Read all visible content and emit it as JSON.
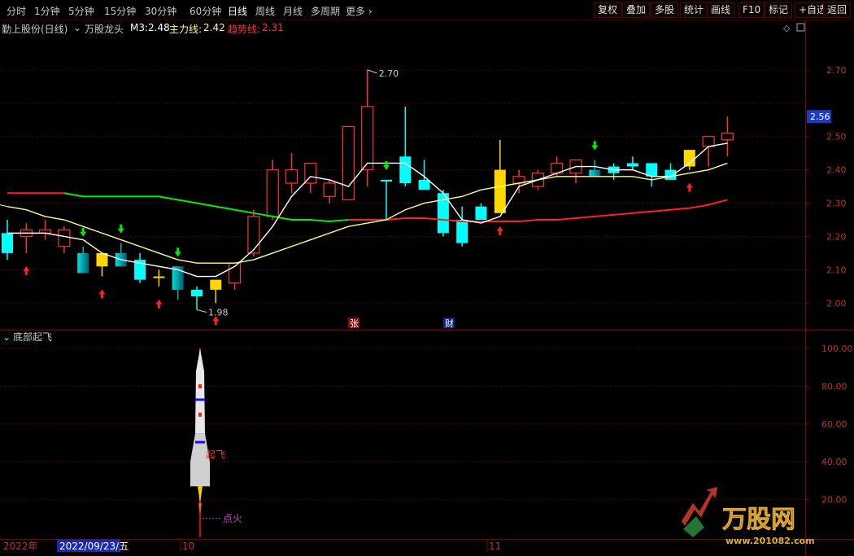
{
  "toolbar": {
    "periods": [
      "分时",
      "1分钟",
      "5分钟",
      "15分钟",
      "30分钟",
      "60分钟",
      "日线",
      "周线",
      "月线",
      "多周期",
      "更多"
    ],
    "active_period": "日线",
    "buttons": [
      "复权",
      "叠加",
      "多股",
      "统计",
      "画线",
      "F10",
      "标记",
      "+自选",
      "返回"
    ]
  },
  "info": {
    "stock": "勤上股份(日线)",
    "indicator": "万股龙头",
    "m3_label": "M3:",
    "m3_value": "2.48",
    "main_label": "主力线:",
    "main_value": "2.42",
    "trend_label": "趋势线:",
    "trend_value": "2.31"
  },
  "sub_panel": {
    "title": "底部起飞",
    "rocket_label": "起飞",
    "ignite_label": "点火"
  },
  "dates": {
    "year": "2022年",
    "selected": "2022/09/23/五",
    "m1": "10",
    "m2": "11"
  },
  "markers": {
    "zhang": "张",
    "cai": "财"
  },
  "watermark": {
    "brand": "万股网",
    "url": "www.201082.com"
  },
  "colors": {
    "up": "#ff3232",
    "down_cyan": "#00ffff",
    "down_teal": "#00b4b4",
    "gold": "#ffd700",
    "m3": "#ffffff",
    "main": "#ffff80",
    "trend_up": "#ff2020",
    "trend_down": "#00ff00"
  },
  "chart_data": [
    {
      "type": "candlestick",
      "title": "勤上股份(日线)",
      "y_ticks": [
        2.0,
        2.1,
        2.2,
        2.3,
        2.4,
        2.5,
        2.7
      ],
      "current_price": 2.56,
      "candles": [
        {
          "o": 2.15,
          "h": 2.25,
          "l": 2.13,
          "c": 2.21,
          "col": "cyan"
        },
        {
          "o": 2.2,
          "h": 2.24,
          "l": 2.15,
          "c": 2.22,
          "col": "red"
        },
        {
          "o": 2.21,
          "h": 2.25,
          "l": 2.19,
          "c": 2.22,
          "col": "red"
        },
        {
          "o": 2.17,
          "h": 2.23,
          "l": 2.15,
          "c": 2.22,
          "col": "red"
        },
        {
          "o": 2.15,
          "h": 2.17,
          "l": 2.09,
          "c": 2.09,
          "col": "teal"
        },
        {
          "o": 2.15,
          "h": 2.15,
          "l": 2.08,
          "c": 2.11,
          "col": "gold"
        },
        {
          "o": 2.15,
          "h": 2.18,
          "l": 2.11,
          "c": 2.11,
          "col": "teal"
        },
        {
          "o": 2.13,
          "h": 2.15,
          "l": 2.06,
          "c": 2.07,
          "col": "cyan"
        },
        {
          "o": 2.08,
          "h": 2.1,
          "l": 2.05,
          "c": 2.08,
          "col": "gold"
        },
        {
          "o": 2.11,
          "h": 2.11,
          "l": 2.01,
          "c": 2.04,
          "col": "teal"
        },
        {
          "o": 2.04,
          "h": 2.05,
          "l": 1.98,
          "c": 2.02,
          "col": "cyan"
        },
        {
          "o": 2.04,
          "h": 2.07,
          "l": 2.0,
          "c": 2.07,
          "col": "gold"
        },
        {
          "o": 2.06,
          "h": 2.12,
          "l": 2.04,
          "c": 2.12,
          "col": "red"
        },
        {
          "o": 2.15,
          "h": 2.28,
          "l": 2.14,
          "c": 2.26,
          "col": "red"
        },
        {
          "o": 2.26,
          "h": 2.43,
          "l": 2.25,
          "c": 2.4,
          "col": "red"
        },
        {
          "o": 2.36,
          "h": 2.45,
          "l": 2.33,
          "c": 2.4,
          "col": "red"
        },
        {
          "o": 2.36,
          "h": 2.42,
          "l": 2.33,
          "c": 2.42,
          "col": "red"
        },
        {
          "o": 2.32,
          "h": 2.37,
          "l": 2.3,
          "c": 2.36,
          "col": "red"
        },
        {
          "o": 2.31,
          "h": 2.53,
          "l": 2.31,
          "c": 2.53,
          "col": "red"
        },
        {
          "o": 2.4,
          "h": 2.7,
          "l": 2.35,
          "c": 2.59,
          "col": "red"
        },
        {
          "o": 2.37,
          "h": 2.37,
          "l": 2.25,
          "c": 2.37,
          "col": "cyan"
        },
        {
          "o": 2.44,
          "h": 2.59,
          "l": 2.35,
          "c": 2.36,
          "col": "cyan"
        },
        {
          "o": 2.37,
          "h": 2.43,
          "l": 2.34,
          "c": 2.34,
          "col": "cyan"
        },
        {
          "o": 2.33,
          "h": 2.34,
          "l": 2.2,
          "c": 2.21,
          "col": "cyan"
        },
        {
          "o": 2.25,
          "h": 2.29,
          "l": 2.17,
          "c": 2.18,
          "col": "cyan"
        },
        {
          "o": 2.29,
          "h": 2.3,
          "l": 2.25,
          "c": 2.25,
          "col": "cyan"
        },
        {
          "o": 2.4,
          "h": 2.49,
          "l": 2.27,
          "c": 2.27,
          "col": "gold"
        },
        {
          "o": 2.36,
          "h": 2.4,
          "l": 2.33,
          "c": 2.38,
          "col": "red"
        },
        {
          "o": 2.35,
          "h": 2.4,
          "l": 2.34,
          "c": 2.39,
          "col": "red"
        },
        {
          "o": 2.39,
          "h": 2.44,
          "l": 2.38,
          "c": 2.42,
          "col": "red"
        },
        {
          "o": 2.39,
          "h": 2.43,
          "l": 2.36,
          "c": 2.43,
          "col": "red"
        },
        {
          "o": 2.4,
          "h": 2.43,
          "l": 2.38,
          "c": 2.38,
          "col": "teal"
        },
        {
          "o": 2.41,
          "h": 2.42,
          "l": 2.37,
          "c": 2.39,
          "col": "cyan"
        },
        {
          "o": 2.42,
          "h": 2.44,
          "l": 2.4,
          "c": 2.41,
          "col": "cyan"
        },
        {
          "o": 2.42,
          "h": 2.42,
          "l": 2.35,
          "c": 2.38,
          "col": "cyan"
        },
        {
          "o": 2.4,
          "h": 2.42,
          "l": 2.37,
          "c": 2.37,
          "col": "cyan"
        },
        {
          "o": 2.41,
          "h": 2.46,
          "l": 2.4,
          "c": 2.46,
          "col": "gold"
        },
        {
          "o": 2.47,
          "h": 2.5,
          "l": 2.41,
          "c": 2.5,
          "col": "red"
        },
        {
          "o": 2.49,
          "h": 2.56,
          "l": 2.44,
          "c": 2.51,
          "col": "red"
        }
      ],
      "m3_line": [
        2.21,
        2.21,
        2.21,
        2.2,
        2.19,
        2.15,
        2.13,
        2.12,
        2.11,
        2.1,
        2.08,
        2.08,
        2.11,
        2.16,
        2.23,
        2.32,
        2.38,
        2.37,
        2.35,
        2.42,
        2.42,
        2.42,
        2.38,
        2.33,
        2.25,
        2.24,
        2.26,
        2.35,
        2.37,
        2.39,
        2.41,
        2.41,
        2.4,
        2.4,
        2.38,
        2.38,
        2.42,
        2.47,
        2.48
      ],
      "main_line": [
        2.29,
        2.28,
        2.26,
        2.25,
        2.23,
        2.21,
        2.19,
        2.17,
        2.15,
        2.13,
        2.12,
        2.12,
        2.12,
        2.13,
        2.15,
        2.17,
        2.19,
        2.21,
        2.23,
        2.24,
        2.25,
        2.28,
        2.3,
        2.31,
        2.32,
        2.34,
        2.35,
        2.36,
        2.37,
        2.38,
        2.38,
        2.38,
        2.38,
        2.38,
        2.37,
        2.38,
        2.39,
        2.4,
        2.42
      ],
      "trend_line": [
        2.33,
        2.33,
        2.33,
        2.33,
        2.32,
        2.32,
        2.32,
        2.32,
        2.32,
        2.31,
        2.3,
        2.29,
        2.28,
        2.27,
        2.26,
        2.25,
        2.25,
        2.245,
        2.25,
        2.25,
        2.25,
        2.255,
        2.255,
        2.25,
        2.245,
        2.245,
        2.245,
        2.245,
        2.25,
        2.25,
        2.255,
        2.26,
        2.265,
        2.27,
        2.275,
        2.28,
        2.285,
        2.295,
        2.31
      ],
      "trend_green_until": 18,
      "labels": {
        "high": "2.70",
        "low": "1.98"
      },
      "up_arrows": [
        1,
        5,
        8,
        11,
        26,
        36
      ],
      "down_arrows": [
        4,
        6,
        9,
        20,
        31
      ]
    },
    {
      "type": "bar",
      "title": "底部起飞",
      "y_ticks": [
        20.0,
        40.0,
        60.0,
        80.0,
        100.0
      ],
      "ylim": [
        0,
        100
      ]
    }
  ]
}
